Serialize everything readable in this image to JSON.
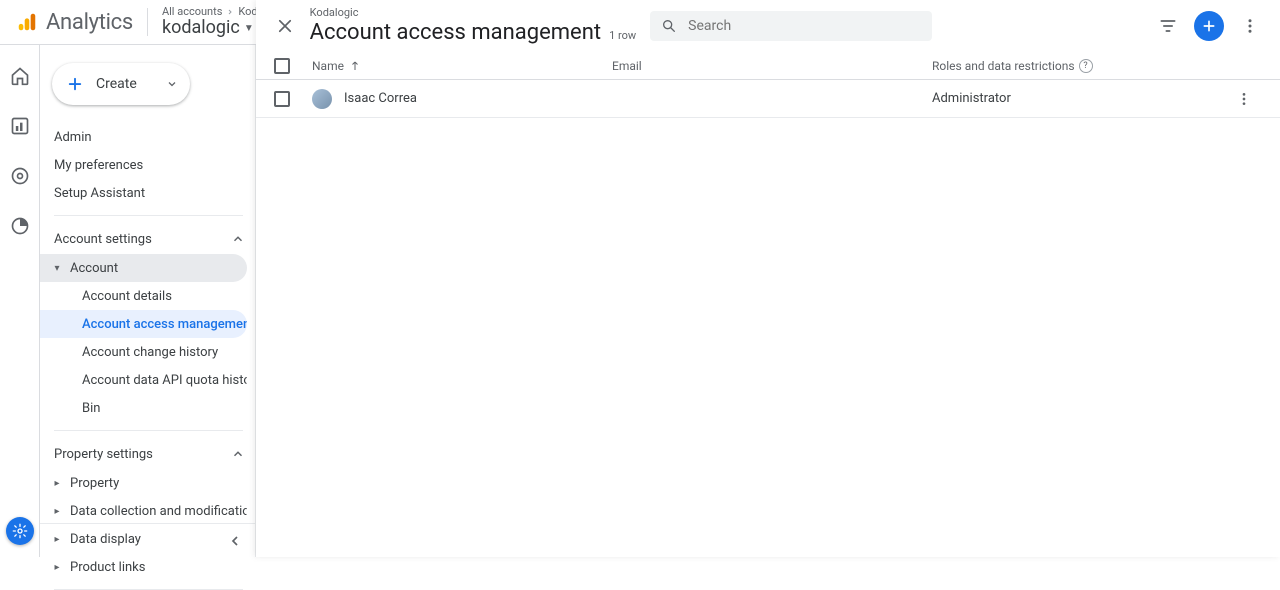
{
  "header": {
    "product": "Analytics",
    "crumb_all": "All accounts",
    "crumb_account": "Kodalogic",
    "account_selector": "kodalogic"
  },
  "sidebar": {
    "create_label": "Create",
    "top_items": [
      "Admin",
      "My preferences",
      "Setup Assistant"
    ],
    "group_account_settings": "Account settings",
    "account_node": "Account",
    "account_children": [
      "Account details",
      "Account access management",
      "Account change history",
      "Account data API quota history",
      "Bin"
    ],
    "group_property_settings": "Property settings",
    "property_children": [
      "Property",
      "Data collection and modification",
      "Data display",
      "Product links"
    ]
  },
  "panel": {
    "breadcrumb": "Kodalogic",
    "title": "Account access management",
    "row_count": "1 row",
    "search_placeholder": "Search",
    "columns": {
      "name": "Name",
      "email": "Email",
      "role": "Roles and data restrictions"
    },
    "rows": [
      {
        "name": "Isaac Correa",
        "email": "",
        "role": "Administrator"
      }
    ]
  }
}
